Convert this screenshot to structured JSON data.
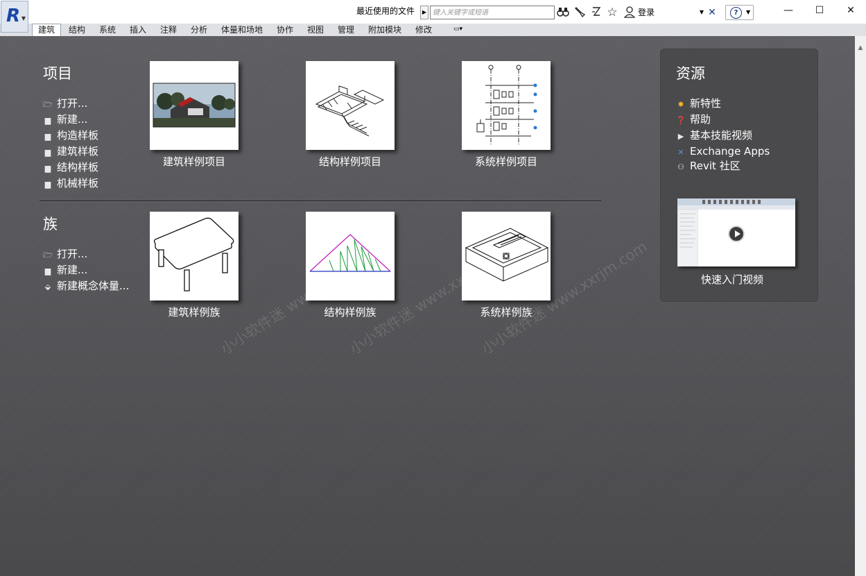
{
  "titlebar": {
    "recent_files_label": "最近使用的文件",
    "search_placeholder": "键入关键字或短语",
    "login_label": "登录",
    "window_buttons": {
      "minimize": "—",
      "maximize": "☐",
      "close": "✕"
    }
  },
  "ribbon": {
    "tabs": [
      "建筑",
      "结构",
      "系统",
      "插入",
      "注释",
      "分析",
      "体量和场地",
      "协作",
      "视图",
      "管理",
      "附加模块",
      "修改"
    ],
    "active_tab": "建筑"
  },
  "projects": {
    "title": "项目",
    "links": [
      "打开...",
      "新建...",
      "构造样板",
      "建筑样板",
      "结构样板",
      "机械样板"
    ],
    "cards": [
      "建筑样例项目",
      "结构样例项目",
      "系统样例项目"
    ]
  },
  "families": {
    "title": "族",
    "links": [
      "打开...",
      "新建...",
      "新建概念体量..."
    ],
    "cards": [
      "建筑样例族",
      "结构样例族",
      "系统样例族"
    ]
  },
  "resources": {
    "title": "资源",
    "links": [
      "新特性",
      "帮助",
      "基本技能视频",
      "Exchange Apps",
      "Revit 社区"
    ],
    "video_label": "快速入门视频"
  },
  "watermark": [
    "小小软件迷 www.xxrjm.com",
    "小小软件迷 www.xxrjm.com",
    "小小软件迷 www.xxrjm.com"
  ],
  "colors": {
    "accent": "#1a47a8",
    "background": "#56565a",
    "panel": "#4a4a4c"
  }
}
